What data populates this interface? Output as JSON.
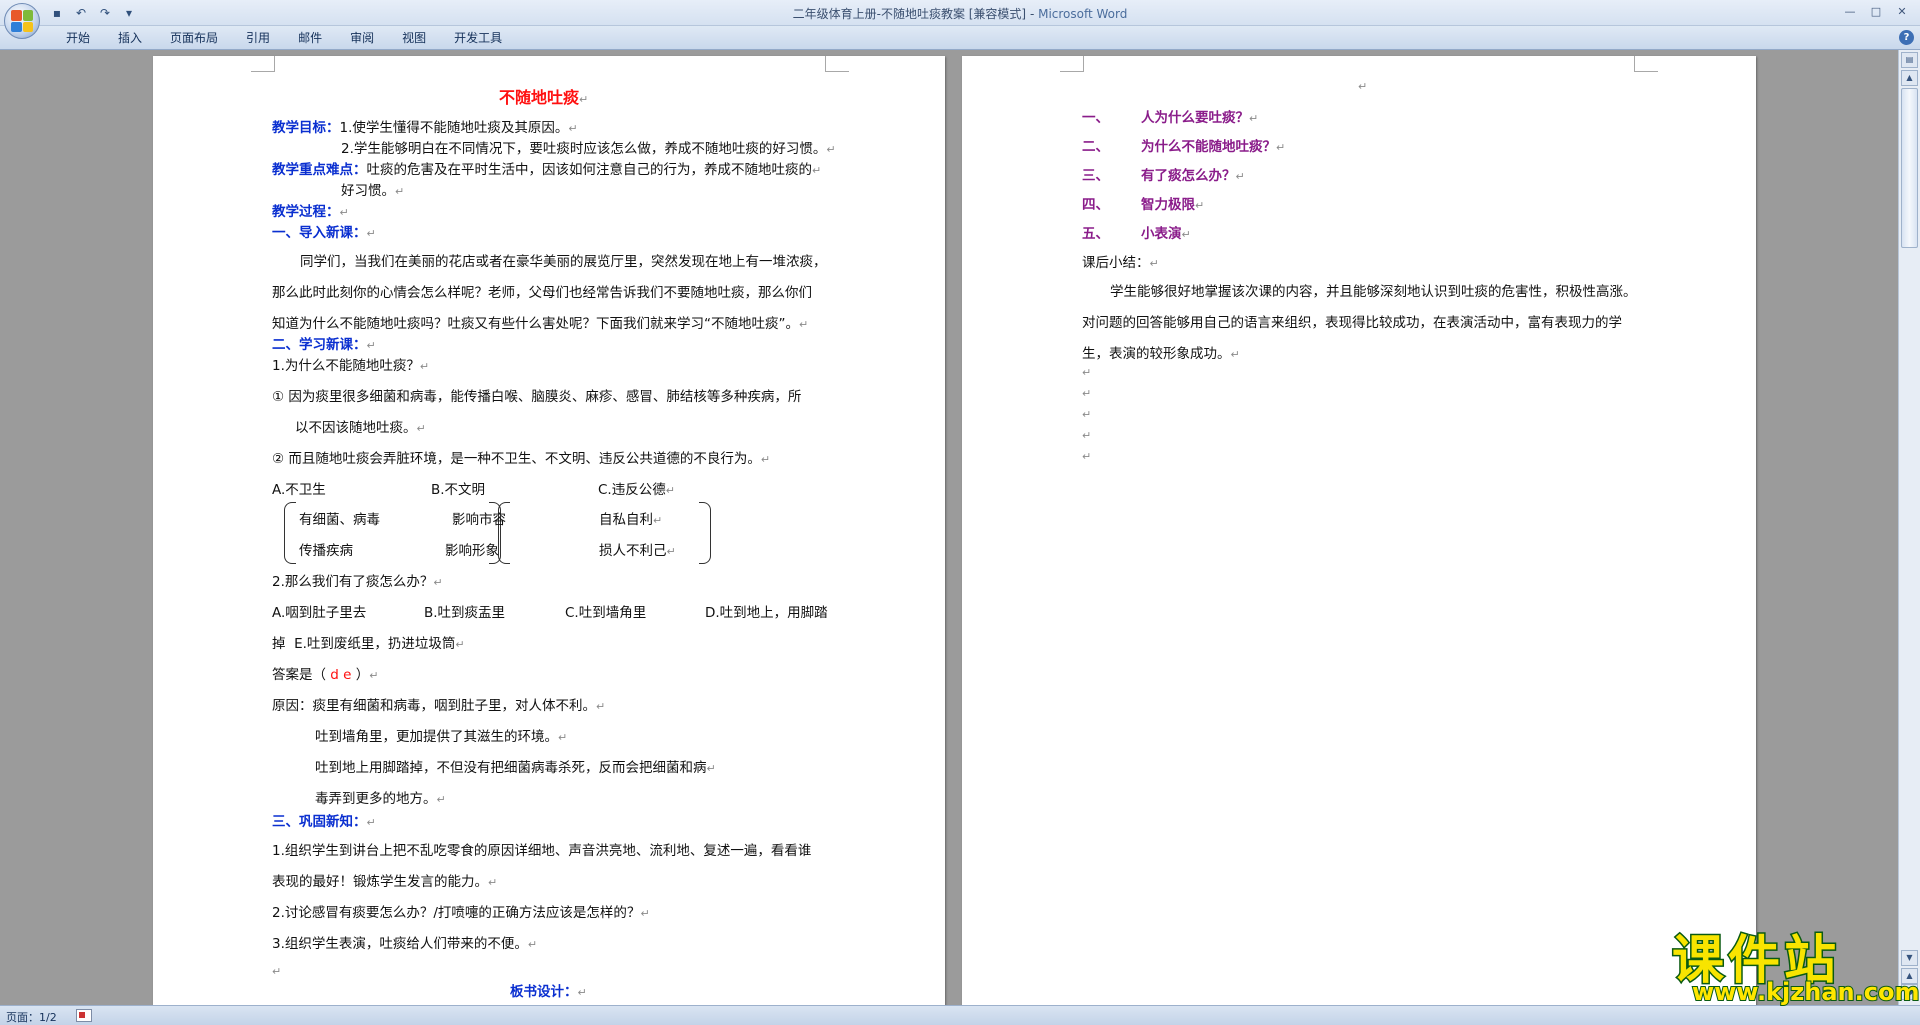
{
  "window": {
    "doc_title": "二年级体育上册-不随地吐痰教案 [兼容模式]",
    "separator": " - ",
    "app_name": "Microsoft Word",
    "qat_save": "▪",
    "qat_undo": "↶",
    "qat_redo": "↷",
    "qat_more": "▾",
    "min": "—",
    "max": "□",
    "close": "✕"
  },
  "ribbon": {
    "tabs": [
      "开始",
      "插入",
      "页面布局",
      "引用",
      "邮件",
      "审阅",
      "视图",
      "开发工具"
    ],
    "help": "?"
  },
  "left_page": {
    "title": "不随地吐痰",
    "goal_label": "教学目标：",
    "goal_1": "1.使学生懂得不能随地吐痰及其原因。",
    "goal_2": "2.学生能够明白在不同情况下，要吐痰时应该怎么做，养成不随地吐痰的好习惯。",
    "key_label": "教学重点难点：",
    "key_1": "吐痰的危害及在平时生活中，因该如何注意自己的行为，养成不随地吐痰的",
    "key_2": "好习惯。",
    "process_label": "教学过程：",
    "sec1_title": "一、导入新课：",
    "intro_1": "同学们，当我们在美丽的花店或者在豪华美丽的展览厅里，突然发现在地上有一堆浓痰，",
    "intro_2": "那么此时此刻你的心情会怎么样呢？老师，父母们也经常告诉我们不要随地吐痰，那么你们",
    "intro_3": "知道为什么不能随地吐痰吗？吐痰又有些什么害处呢？下面我们就来学习“不随地吐痰”。",
    "sec2_title": "二、学习新课：",
    "q1": "1.为什么不能随地吐痰？",
    "r1a": "①  因为痰里很多细菌和病毒，能传播白喉、脑膜炎、麻疹、感冒、肺结核等多种疾病，所",
    "r1b": "以不因该随地吐痰。",
    "r2": "②  而且随地吐痰会弄脏环境，是一种不卫生、不文明、违反公共道德的不良行为。",
    "opt_a": "A.不卫生",
    "opt_b": "B.不文明",
    "opt_c": "C.违反公德",
    "m1": "有细菌、病毒",
    "m2": "影响市容",
    "m3": "自私自利",
    "m4": "传播疾病",
    "m5": "影响形象",
    "m6": "损人不利己",
    "q2": "2.那么我们有了痰怎么办？",
    "c_a": "A.咽到肚子里去",
    "c_b": "B.吐到痰盂里",
    "c_c": "C.吐到墙角里",
    "c_d": "D.吐到地上，用脚踏",
    "c_e1": "掉",
    "c_e2": "E.吐到废纸里，扔进垃圾筒",
    "answer_prefix": "答案是（",
    "answer_value": "d e",
    "answer_suffix": "）",
    "reason_1": "原因：痰里有细菌和病毒，咽到肚子里，对人体不利。",
    "reason_2": "吐到墙角里，更加提供了其滋生的环境。",
    "reason_3": "吐到地上用脚踏掉，不但没有把细菌病毒杀死，反而会把细菌和病",
    "reason_4": "毒弄到更多的地方。",
    "sec3_title": "三、巩固新知：",
    "p1a": "1.组织学生到讲台上把不乱吃零食的原因详细地、声音洪亮地、流利地、复述一遍，看看谁",
    "p1b": "表现的最好！锻炼学生发言的能力。",
    "p2": "2.讨论感冒有痰要怎么办？/打喷嚏的正确方法应该是怎样的？",
    "p3": "3.组织学生表演，吐痰给人们带来的不便。",
    "board": "板书设计："
  },
  "right_page": {
    "board_items": [
      {
        "num": "一、",
        "text": "人为什么要吐痰？"
      },
      {
        "num": "二、",
        "text": "为什么不能随地吐痰？"
      },
      {
        "num": "三、",
        "text": "有了痰怎么办？"
      },
      {
        "num": "四、",
        "text": "智力极限"
      },
      {
        "num": "五、",
        "text": "小表演"
      }
    ],
    "summary_label": "课后小结：",
    "summary_1": "学生能够很好地掌握该次课的内容，并且能够深刻地认识到吐痰的危害性，积极性高涨。",
    "summary_2": "对问题的回答能够用自己的语言来组织，表现得比较成功，在表演活动中，富有表现力的学",
    "summary_3": "生，表演的较形象成功。"
  },
  "marks": {
    "para": "↵"
  },
  "status": {
    "page": "页面：1/2"
  },
  "watermark": {
    "cn": "课件站",
    "url": "www.kjzhan.com"
  },
  "colors": {
    "heading_blue": "#0a2fd0",
    "title_red": "#ff1010",
    "board_purple": "#8a1c8a"
  }
}
